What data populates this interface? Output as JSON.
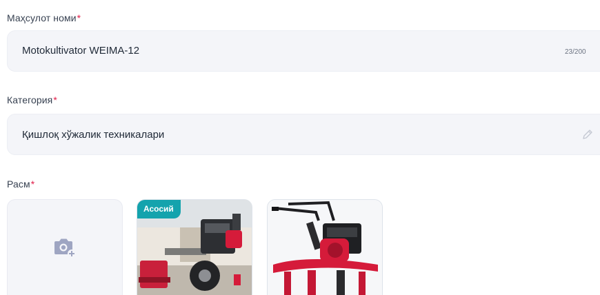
{
  "product_name": {
    "label": "Маҳсулот номи",
    "required_mark": "*",
    "value": "Motokultivator WEIMA-12",
    "counter": "23/200"
  },
  "category": {
    "label": "Категория",
    "required_mark": "*",
    "value": "Қишлоқ хўжалик техникалари",
    "edit_icon": "pencil-icon"
  },
  "images": {
    "label": "Расм",
    "required_mark": "*",
    "upload_icon": "camera-add-icon",
    "main_badge": "Асосий",
    "items": [
      {
        "kind": "photo",
        "is_main": true
      },
      {
        "kind": "photo",
        "is_main": false
      }
    ]
  },
  "colors": {
    "field_bg": "#f4f5f9",
    "required": "#e11d48",
    "badge": "#14a3ad",
    "machine_red": "#d51b3a"
  }
}
